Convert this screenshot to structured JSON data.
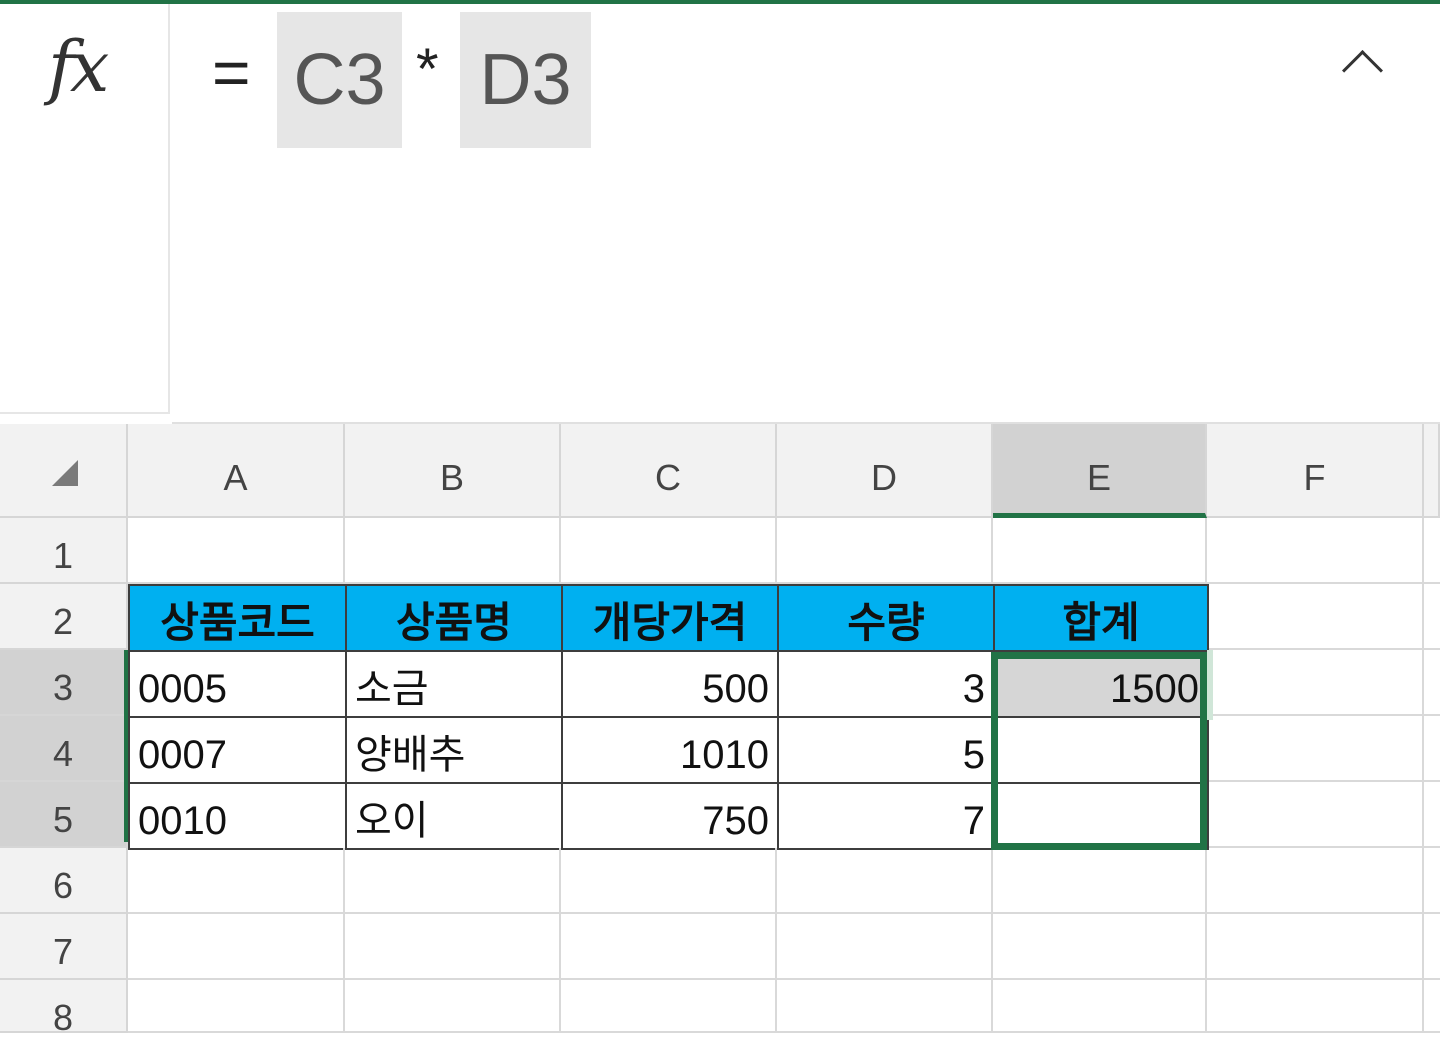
{
  "formula_bar": {
    "fx_label": "fx",
    "equals": "=",
    "ref1": "C3",
    "operator": "*",
    "ref2": "D3"
  },
  "columns": [
    "A",
    "B",
    "C",
    "D",
    "E",
    "F"
  ],
  "rows": [
    "1",
    "2",
    "3",
    "4",
    "5",
    "6",
    "7",
    "8"
  ],
  "table": {
    "headers": [
      "상품코드",
      "상품명",
      "개당가격",
      "수량",
      "합계"
    ],
    "rows": [
      {
        "code": "0005",
        "name": "소금",
        "price": "500",
        "qty": "3",
        "total": "1500"
      },
      {
        "code": "0007",
        "name": "양배추",
        "price": "1010",
        "qty": "5",
        "total": ""
      },
      {
        "code": "0010",
        "name": "오이",
        "price": "750",
        "qty": "7",
        "total": ""
      }
    ]
  },
  "selection": {
    "active_cell": "E3",
    "selected_column": "E",
    "selected_rows": [
      "3",
      "4",
      "5"
    ]
  },
  "colors": {
    "accent": "#217346",
    "header_fill": "#00b0f0"
  }
}
